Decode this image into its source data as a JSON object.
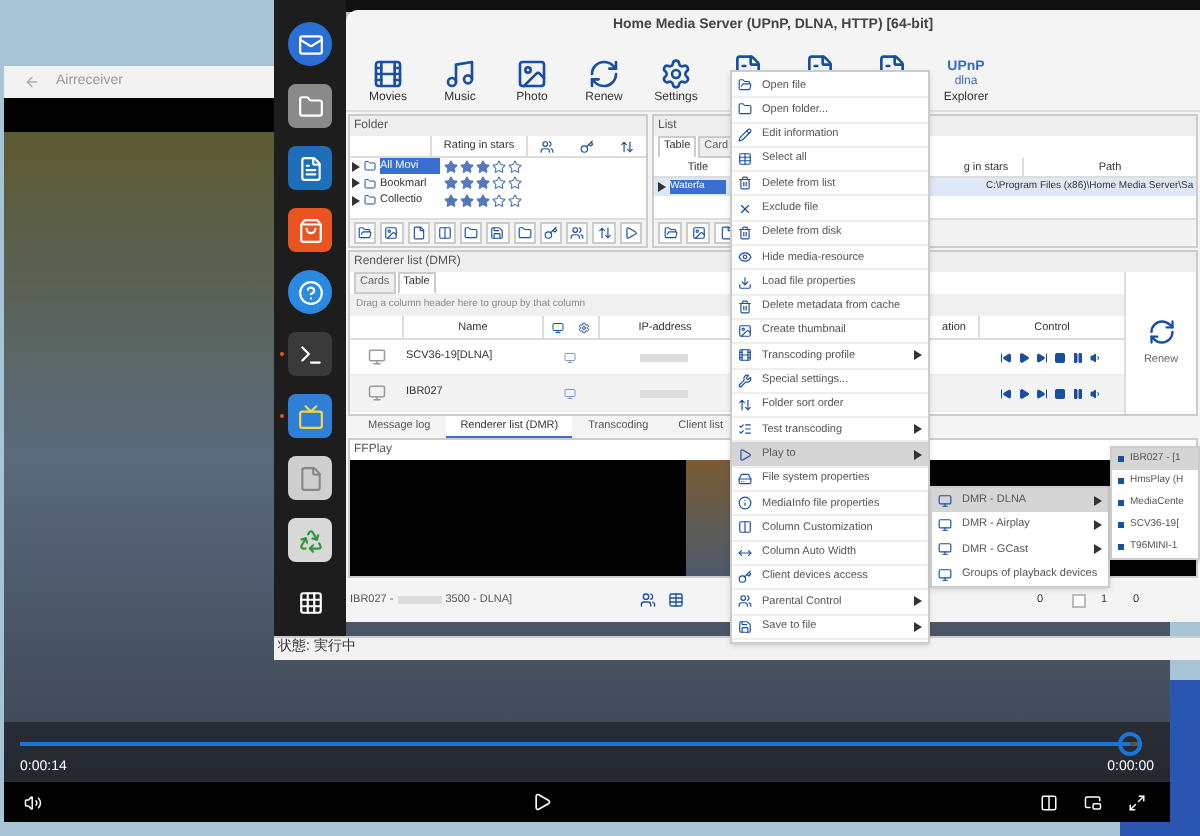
{
  "player": {
    "title": "Airreceiver",
    "elapsed": "0:00:14",
    "remaining": "0:00:00",
    "progress": {
      "level": 0.99
    }
  },
  "dock": {
    "items": [
      {
        "kind": "mail",
        "running": false
      },
      {
        "kind": "files",
        "running": false
      },
      {
        "kind": "writer",
        "running": false
      },
      {
        "kind": "store",
        "running": false
      },
      {
        "kind": "help",
        "running": false
      },
      {
        "kind": "terminal",
        "running": true
      },
      {
        "kind": "media",
        "running": true
      },
      {
        "kind": "blank",
        "running": false
      },
      {
        "kind": "trash",
        "running": false
      },
      {
        "kind": "apps",
        "running": false
      }
    ]
  },
  "hms": {
    "title": "Home Media Server (UPnP, DLNA, HTTP) [64-bit]",
    "toolbar": [
      {
        "kind": "movies",
        "label": "Movies"
      },
      {
        "kind": "music",
        "label": "Music"
      },
      {
        "kind": "photo",
        "label": "Photo"
      },
      {
        "kind": "renew",
        "label": "Renew"
      },
      {
        "kind": "settings",
        "label": "Settings"
      },
      {
        "kind": "doc"
      },
      {
        "kind": "doc"
      },
      {
        "kind": "doc"
      },
      {
        "kind": "upnp",
        "logo_top": "UPnP",
        "logo_bottom": "dlna",
        "label": "Explorer"
      }
    ],
    "folder_panel": {
      "title": "Folder",
      "column": "Rating in stars",
      "rows": [
        {
          "name": "All Movi",
          "stars": 3,
          "selected": true
        },
        {
          "name": "Bookmarl",
          "stars": 3,
          "selected": false
        },
        {
          "name": "Collectio",
          "stars": 3,
          "selected": false
        }
      ]
    },
    "list_panel": {
      "title": "List",
      "tabs": [
        {
          "label": "Table",
          "selected": true
        },
        {
          "label": "Card",
          "selected": false
        }
      ],
      "columns": [
        "Title",
        "g in stars",
        "Path"
      ],
      "row": {
        "title": "Waterfa",
        "path": "C:\\Program Files (x86)\\Home Media Server\\Sa",
        "selected": true
      }
    },
    "renderer_panel": {
      "title": "Renderer list (DMR)",
      "tabs": [
        {
          "label": "Cards",
          "selected": false
        },
        {
          "label": "Table",
          "selected": true
        }
      ],
      "hint": "Drag a column header here to group by that column",
      "columns": [
        "Name",
        "IP-address",
        "ation",
        "Control"
      ],
      "rows": [
        {
          "name": "SCV36-19[DLNA]"
        },
        {
          "name": "IBR027"
        }
      ],
      "renew": "Renew"
    },
    "bottom_tabs": [
      {
        "label": "Message log",
        "selected": false
      },
      {
        "label": "Renderer list (DMR)",
        "selected": true
      },
      {
        "label": "Transcoding",
        "selected": false
      },
      {
        "label": "Client list",
        "selected": false
      }
    ],
    "ffplay": {
      "title": "FFPlay"
    },
    "status": {
      "device": "IBR027 -",
      "suffix": "3500 - DLNA]",
      "counts": [
        "0",
        "1",
        "0"
      ],
      "checked": false
    }
  },
  "app_status": "状態: 実行中",
  "context_menu": [
    {
      "label": "Open file",
      "submenu": false,
      "selected": false
    },
    {
      "label": "Open folder...",
      "submenu": false,
      "selected": false
    },
    {
      "label": "Edit information",
      "submenu": false,
      "selected": false
    },
    {
      "label": "Select all",
      "submenu": false,
      "selected": false
    },
    {
      "label": "Delete from list",
      "submenu": false,
      "selected": false
    },
    {
      "label": "Exclude file",
      "submenu": false,
      "selected": false
    },
    {
      "label": "Delete from disk",
      "submenu": false,
      "selected": false
    },
    {
      "label": "Hide media-resource",
      "submenu": false,
      "selected": false
    },
    {
      "label": "Load file properties",
      "submenu": false,
      "selected": false
    },
    {
      "label": "Delete metadata from cache",
      "submenu": false,
      "selected": false
    },
    {
      "label": "Create thumbnail",
      "submenu": false,
      "selected": false
    },
    {
      "label": "Transcoding profile",
      "submenu": true,
      "selected": false
    },
    {
      "label": "Special settings...",
      "submenu": false,
      "selected": false
    },
    {
      "label": "Folder sort order",
      "submenu": false,
      "selected": false
    },
    {
      "label": "Test transcoding",
      "submenu": true,
      "selected": false
    },
    {
      "label": "Play to",
      "submenu": true,
      "selected": true
    },
    {
      "label": "File system properties",
      "submenu": false,
      "selected": false
    },
    {
      "label": "MediaInfo file properties",
      "submenu": false,
      "selected": false
    },
    {
      "label": "Column Customization",
      "submenu": false,
      "selected": false
    },
    {
      "label": "Column Auto Width",
      "submenu": false,
      "selected": false
    },
    {
      "label": "Client devices access",
      "submenu": false,
      "selected": false
    },
    {
      "label": "Parental Control",
      "submenu": true,
      "selected": false
    },
    {
      "label": "Save to file",
      "submenu": true,
      "selected": false
    }
  ],
  "submenu": [
    {
      "label": "DMR - DLNA",
      "submenu": true,
      "selected": true
    },
    {
      "label": "DMR - Airplay",
      "submenu": true,
      "selected": false
    },
    {
      "label": "DMR - GCast",
      "submenu": true,
      "selected": false
    },
    {
      "label": "Groups of playback devices",
      "submenu": false,
      "selected": false
    }
  ],
  "device_menu": [
    {
      "label": "IBR027 - [1",
      "selected": true
    },
    {
      "label": "HmsPlay (H",
      "selected": false
    },
    {
      "label": "MediaCente",
      "selected": false
    },
    {
      "label": "SCV36-19[",
      "selected": false
    },
    {
      "label": "T96MINI-1",
      "selected": false
    }
  ]
}
